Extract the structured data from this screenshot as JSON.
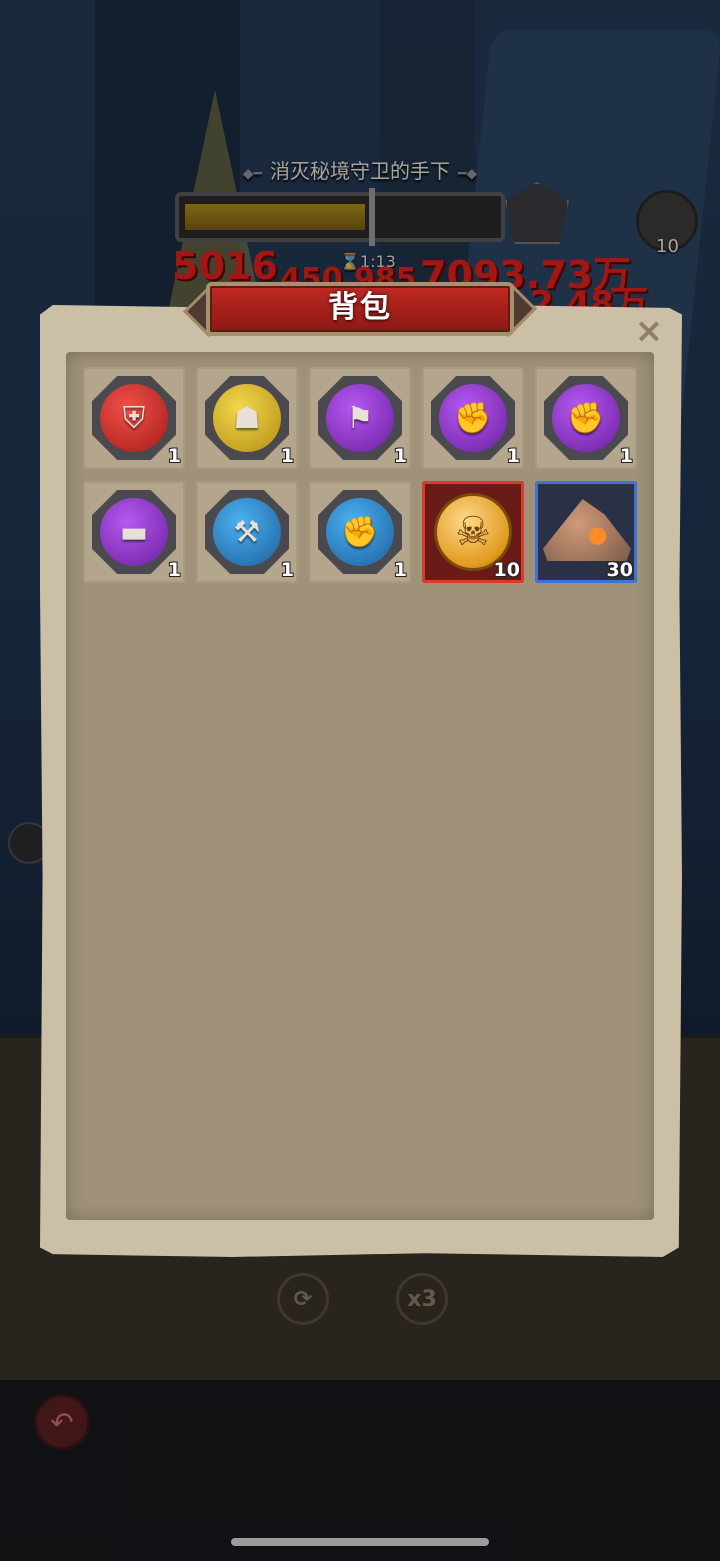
{
  "hud": {
    "quest_title": "消灭秘境守卫的手下",
    "timer": "1:13",
    "chest_count": "10",
    "damage_numbers": [
      "5016",
      "450.985",
      "7093.73万",
      "2.48万"
    ],
    "boss_progress": 0.58,
    "speed_button": "x3"
  },
  "bag": {
    "title": "背包",
    "close_label": "×",
    "items": [
      {
        "name": "armor",
        "icon": "armor-icon",
        "glyph": "⛨",
        "rarity": "red",
        "count": "1"
      },
      {
        "name": "helmet",
        "icon": "helmet-icon",
        "glyph": "☗",
        "rarity": "gold",
        "count": "1"
      },
      {
        "name": "cape",
        "icon": "cape-icon",
        "glyph": "⚑",
        "rarity": "purple",
        "count": "1"
      },
      {
        "name": "gauntlet",
        "icon": "gauntlet-icon",
        "glyph": "✊",
        "rarity": "purple",
        "count": "1"
      },
      {
        "name": "gauntlet",
        "icon": "gauntlet-icon",
        "glyph": "✊",
        "rarity": "purple",
        "count": "1"
      },
      {
        "name": "belt",
        "icon": "belt-icon",
        "glyph": "▬",
        "rarity": "purple",
        "count": "1"
      },
      {
        "name": "axe",
        "icon": "axe-icon",
        "glyph": "⚒",
        "rarity": "blue",
        "count": "1"
      },
      {
        "name": "gauntlet",
        "icon": "gauntlet-icon",
        "glyph": "✊",
        "rarity": "blue",
        "count": "1"
      },
      {
        "name": "skull-coin",
        "icon": "skull-coin-icon",
        "glyph": "☠",
        "rarity": "coin",
        "count": "10"
      },
      {
        "name": "ore",
        "icon": "ore-icon",
        "glyph": "",
        "rarity": "ore",
        "count": "30"
      }
    ]
  },
  "colors": {
    "banner_red": "#c12a23",
    "panel_parchment": "#cbbfa6",
    "slot_bg": "#b3a68c",
    "rarity_red": "#d93a2a",
    "rarity_blue": "#3d74d4"
  }
}
